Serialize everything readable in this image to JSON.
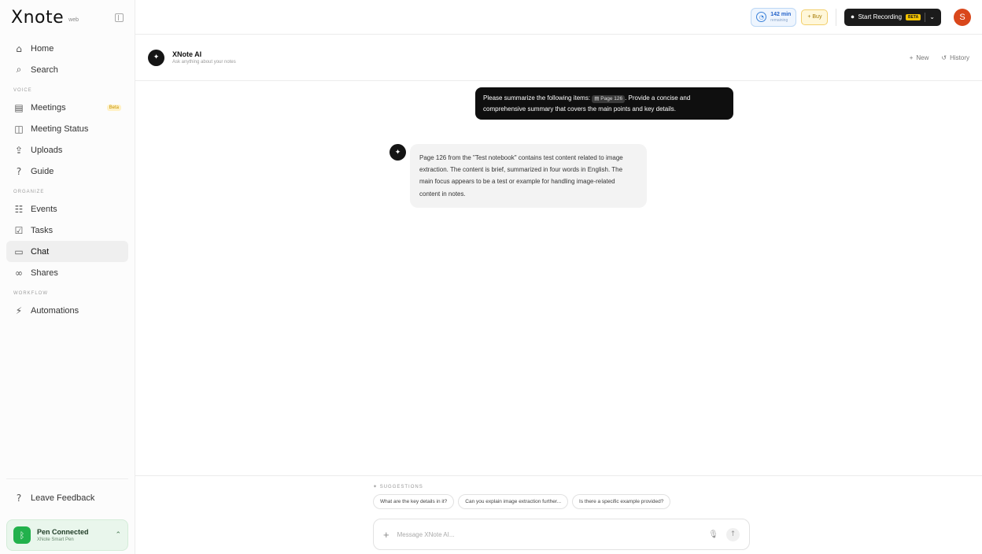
{
  "brand": {
    "logo": "Xnote",
    "sub": "web"
  },
  "sidebar": {
    "items_top": [
      {
        "label": "Home",
        "icon": "⌂"
      },
      {
        "label": "Search",
        "icon": "⌕"
      }
    ],
    "sections": [
      {
        "label": "VOICE",
        "items": [
          {
            "label": "Meetings",
            "icon": "▤",
            "badge": "Beta"
          },
          {
            "label": "Meeting Status",
            "icon": "◫"
          },
          {
            "label": "Uploads",
            "icon": "⇪"
          },
          {
            "label": "Guide",
            "icon": "?"
          }
        ]
      },
      {
        "label": "ORGANIZE",
        "items": [
          {
            "label": "Events",
            "icon": "☷"
          },
          {
            "label": "Tasks",
            "icon": "☑"
          },
          {
            "label": "Chat",
            "icon": "▭"
          },
          {
            "label": "Shares",
            "icon": "∞"
          }
        ]
      },
      {
        "label": "WORKFLOW",
        "items": [
          {
            "label": "Automations",
            "icon": "⚡"
          }
        ]
      }
    ],
    "feedback": "Leave Feedback",
    "pen": {
      "title": "Pen Connected",
      "subtitle": "XNote Smart Pen"
    }
  },
  "topbar": {
    "minutes_value": "142 min",
    "minutes_sub": "remaining",
    "buy_label": "+ Buy",
    "record_label": "Start Recording",
    "record_badge": "BETA",
    "avatar_initial": "S"
  },
  "chat": {
    "title": "XNote AI",
    "subtitle": "Ask anything about your notes",
    "new_label": "New",
    "history_label": "History",
    "user_msg_before": "Please summarize the following items:",
    "user_msg_chip": "Page 126",
    "user_msg_after": ". Provide a concise and comprehensive summary that covers the main points and key details.",
    "bot_msg": "Page 126 from the \"Test notebook\" contains test content related to image extraction. The content is brief, summarized in four words in English. The main focus appears to be a test or example for handling image-related content in notes.",
    "suggestions_label": "SUGGESTIONS",
    "suggestions": [
      "What are the key details in it?",
      "Can you explain image extraction further...",
      "Is there a specific example provided?"
    ],
    "composer_placeholder": "Message XNote AI..."
  }
}
